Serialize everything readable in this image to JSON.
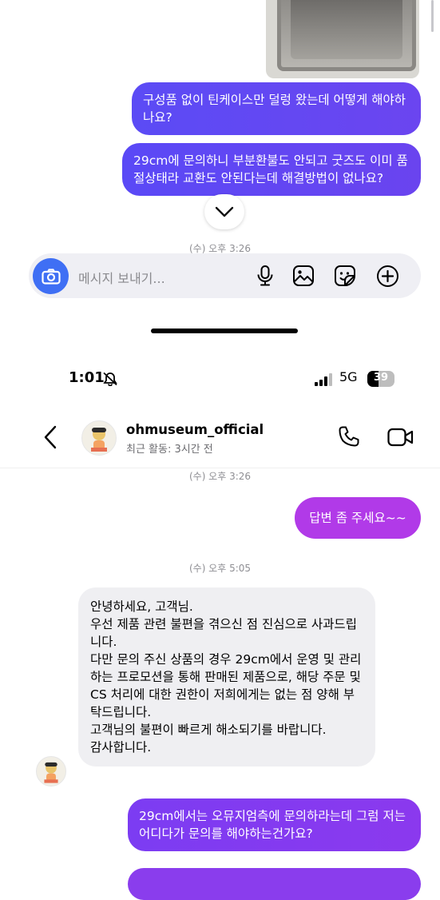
{
  "upper_thread": {
    "messages": [
      {
        "text": "구성품 없이 틴케이스만 덜렁 왔는데 어떻게 해야하나요?"
      },
      {
        "text": "29cm에 문의하니 부분환불도 안되고 굿즈도 이미 품절상태라 교환도 안된다는데 해결방법이 없나요?"
      }
    ],
    "timestamp": "(수) 오후 3:26"
  },
  "composer": {
    "placeholder": "메시지 보내기..."
  },
  "status_bar": {
    "time": "1:01",
    "network": "5G",
    "battery": "39"
  },
  "header": {
    "username": "ohmuseum_official",
    "activity": "최근 활동: 3시간 전"
  },
  "lower_thread": {
    "timestamp_1": "(수) 오후 3:26",
    "sent_1": "답변 좀 주세요~~",
    "timestamp_2": "(수) 오후 5:05",
    "received_1": "안녕하세요, 고객님.\n우선 제품 관련 불편을 겪으신 점 진심으로 사과드립니다.\n다만 문의 주신 상품의 경우 29cm에서 운영 및 관리하는 프로모션을 통해 판매된 제품으로, 해당 주문 및 CS 처리에 대한 권한이 저희에게는 없는 점 양해 부탁드립니다.\n고객님의 불편이 빠르게 해소되기를 바랍니다.\n감사합니다.",
    "sent_2": "29cm에서는 오뮤지엄측에 문의하라는데 그럼 저는 어디다가 문의를 해야하는건가요?"
  },
  "colors": {
    "accent_blue": "#3f6ff4",
    "bubble_purple": "#6b45f0",
    "bubble_magenta": "#b13ae8",
    "incoming_gray": "#efeff2"
  },
  "icons": [
    "chevron-down-icon",
    "camera-icon",
    "microphone-icon",
    "gallery-icon",
    "sticker-icon",
    "plus-icon",
    "back-chevron-icon",
    "phone-icon",
    "video-icon",
    "bell-slash-icon",
    "signal-icon",
    "battery-icon"
  ]
}
